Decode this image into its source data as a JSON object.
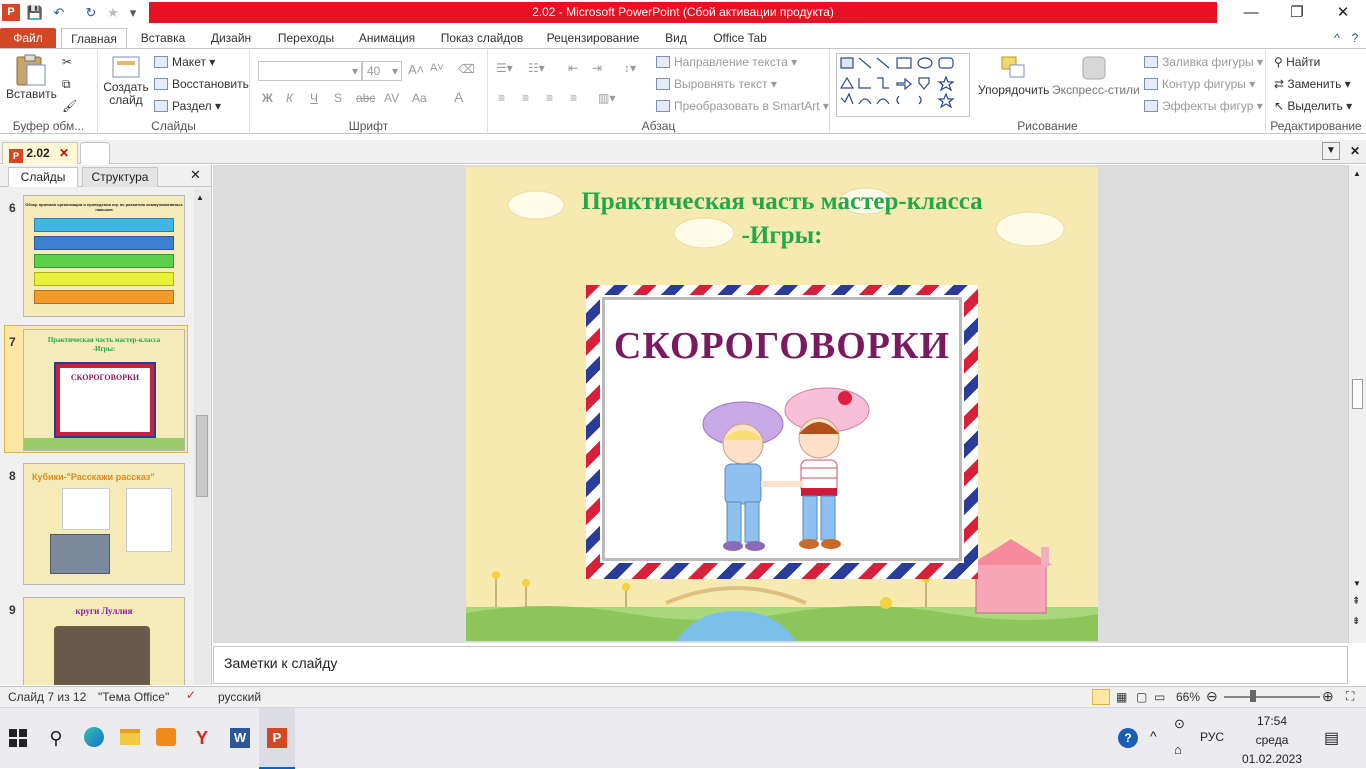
{
  "window": {
    "title": "2.02  -  Microsoft PowerPoint (Сбой активации продукта)",
    "controls": {
      "minimize": "—",
      "restore": "❐",
      "close": "✕"
    }
  },
  "qat": {
    "save": "💾",
    "undo": "↶",
    "redo": "↻",
    "star": "★",
    "customize": "▾"
  },
  "tabs": {
    "file": "Файл",
    "items": [
      "Главная",
      "Вставка",
      "Дизайн",
      "Переходы",
      "Анимация",
      "Показ слайдов",
      "Рецензирование",
      "Вид",
      "Office Tab"
    ]
  },
  "ribbon": {
    "clipboard": {
      "paste": "Вставить",
      "label": "Буфер обм..."
    },
    "slides": {
      "new_slide": "Создать слайд",
      "layout": "Макет",
      "reset": "Восстановить",
      "section": "Раздел",
      "label": "Слайды"
    },
    "font": {
      "font_name": "",
      "font_size": "40",
      "bold": "Ж",
      "italic": "К",
      "underline": "Ч",
      "shadow": "S",
      "strike": "abc",
      "spacing": "AV",
      "case": "Aa",
      "color": "A",
      "label": "Шрифт"
    },
    "paragraph": {
      "text_direction": "Направление текста",
      "align_text": "Выровнять текст",
      "smartart": "Преобразовать в SmartArt",
      "label": "Абзац"
    },
    "drawing": {
      "arrange": "Упорядочить",
      "quick_styles": "Экспресс-стили",
      "fill": "Заливка фигуры",
      "outline": "Контур фигуры",
      "effects": "Эффекты фигур",
      "label": "Рисование"
    },
    "editing": {
      "find": "Найти",
      "replace": "Заменить",
      "select": "Выделить",
      "label": "Редактирование"
    }
  },
  "doc_tab": {
    "name": "2.02"
  },
  "panes": {
    "slides": "Слайды",
    "outline": "Структура"
  },
  "thumbnails": [
    {
      "number": "6",
      "title": "Обзор приемов организации и проведения игр по развитию коммуникативных навыков"
    },
    {
      "number": "7",
      "title": "Практическая часть мастер-класса -Игры:",
      "image_caption": "СКОРОГОВОРКИ"
    },
    {
      "number": "8",
      "title": "Кубики-\"Расскажи рассказ\""
    },
    {
      "number": "9",
      "title": "круги Луллия"
    }
  ],
  "slide": {
    "title_line1": "Практическая часть мастер-класса",
    "title_line2": "-Игры:",
    "image_caption": "СКОРОГОВОРКИ"
  },
  "notes": {
    "placeholder": "Заметки к слайду"
  },
  "status": {
    "slide": "Слайд 7 из 12",
    "theme": "\"Тема Office\"",
    "language": "русский",
    "zoom": "66%"
  },
  "tray": {
    "lang": "РУС",
    "time": "17:54",
    "day": "среда",
    "date": "01.02.2023"
  },
  "colors": {
    "accent": "#d24726",
    "title_bar_red": "#e81123",
    "slide_title": "#22a84a"
  }
}
